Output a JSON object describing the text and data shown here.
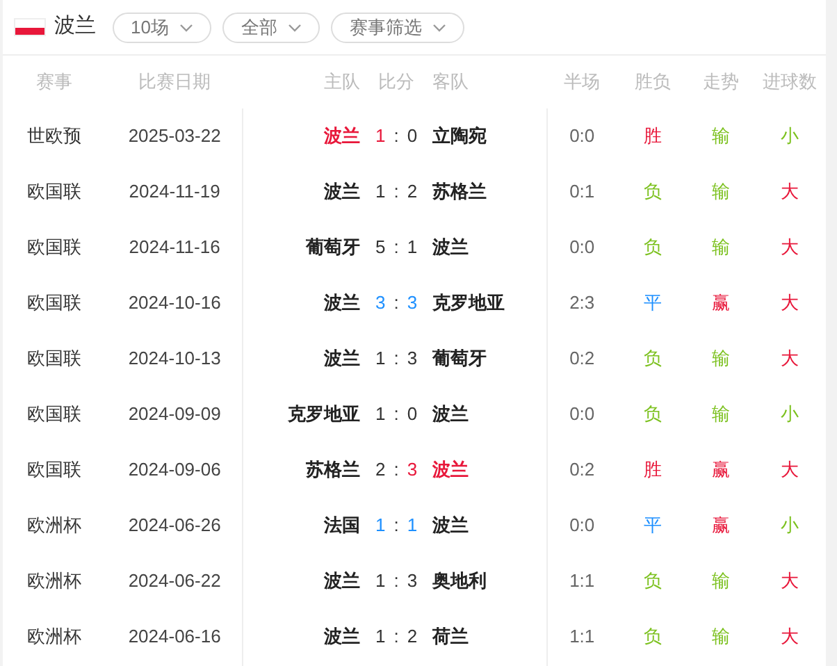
{
  "team": {
    "name": "波兰"
  },
  "filters": [
    {
      "label": "10场"
    },
    {
      "label": "全部"
    },
    {
      "label": "赛事筛选"
    }
  ],
  "columns": [
    "赛事",
    "比赛日期",
    "主队",
    "比分",
    "客队",
    "半场",
    "胜负",
    "走势",
    "进球数"
  ],
  "rows": [
    {
      "league": "世欧预",
      "date": "2025-03-22",
      "home": {
        "text": "波兰",
        "color": "#e8173a"
      },
      "home_score": {
        "text": "1",
        "color": "#e8173a"
      },
      "separator": ":",
      "away_score": {
        "text": "0",
        "color": "#333333"
      },
      "away": {
        "text": "立陶宛",
        "color": "#222222"
      },
      "half": "0:0",
      "result": {
        "text": "胜",
        "color": "#e8173a"
      },
      "trend": {
        "text": "输",
        "color": "#7cc11f"
      },
      "goals": {
        "text": "小",
        "color": "#7cc11f"
      }
    },
    {
      "league": "欧国联",
      "date": "2024-11-19",
      "home": {
        "text": "波兰",
        "color": "#222222"
      },
      "home_score": {
        "text": "1",
        "color": "#333333"
      },
      "separator": ":",
      "away_score": {
        "text": "2",
        "color": "#333333"
      },
      "away": {
        "text": "苏格兰",
        "color": "#222222"
      },
      "half": "0:1",
      "result": {
        "text": "负",
        "color": "#7cc11f"
      },
      "trend": {
        "text": "输",
        "color": "#7cc11f"
      },
      "goals": {
        "text": "大",
        "color": "#e8173a"
      }
    },
    {
      "league": "欧国联",
      "date": "2024-11-16",
      "home": {
        "text": "葡萄牙",
        "color": "#222222"
      },
      "home_score": {
        "text": "5",
        "color": "#333333"
      },
      "separator": ":",
      "away_score": {
        "text": "1",
        "color": "#333333"
      },
      "away": {
        "text": "波兰",
        "color": "#222222"
      },
      "half": "0:0",
      "result": {
        "text": "负",
        "color": "#7cc11f"
      },
      "trend": {
        "text": "输",
        "color": "#7cc11f"
      },
      "goals": {
        "text": "大",
        "color": "#e8173a"
      }
    },
    {
      "league": "欧国联",
      "date": "2024-10-16",
      "home": {
        "text": "波兰",
        "color": "#222222"
      },
      "home_score": {
        "text": "3",
        "color": "#1e90ff"
      },
      "separator": ":",
      "away_score": {
        "text": "3",
        "color": "#1e90ff"
      },
      "away": {
        "text": "克罗地亚",
        "color": "#222222"
      },
      "half": "2:3",
      "result": {
        "text": "平",
        "color": "#1e90ff"
      },
      "trend": {
        "text": "赢",
        "color": "#e8173a"
      },
      "goals": {
        "text": "大",
        "color": "#e8173a"
      }
    },
    {
      "league": "欧国联",
      "date": "2024-10-13",
      "home": {
        "text": "波兰",
        "color": "#222222"
      },
      "home_score": {
        "text": "1",
        "color": "#333333"
      },
      "separator": ":",
      "away_score": {
        "text": "3",
        "color": "#333333"
      },
      "away": {
        "text": "葡萄牙",
        "color": "#222222"
      },
      "half": "0:2",
      "result": {
        "text": "负",
        "color": "#7cc11f"
      },
      "trend": {
        "text": "输",
        "color": "#7cc11f"
      },
      "goals": {
        "text": "大",
        "color": "#e8173a"
      }
    },
    {
      "league": "欧国联",
      "date": "2024-09-09",
      "home": {
        "text": "克罗地亚",
        "color": "#222222"
      },
      "home_score": {
        "text": "1",
        "color": "#333333"
      },
      "separator": ":",
      "away_score": {
        "text": "0",
        "color": "#333333"
      },
      "away": {
        "text": "波兰",
        "color": "#222222"
      },
      "half": "0:0",
      "result": {
        "text": "负",
        "color": "#7cc11f"
      },
      "trend": {
        "text": "输",
        "color": "#7cc11f"
      },
      "goals": {
        "text": "小",
        "color": "#7cc11f"
      }
    },
    {
      "league": "欧国联",
      "date": "2024-09-06",
      "home": {
        "text": "苏格兰",
        "color": "#222222"
      },
      "home_score": {
        "text": "2",
        "color": "#333333"
      },
      "separator": ":",
      "away_score": {
        "text": "3",
        "color": "#e8173a"
      },
      "away": {
        "text": "波兰",
        "color": "#e8173a"
      },
      "half": "0:2",
      "result": {
        "text": "胜",
        "color": "#e8173a"
      },
      "trend": {
        "text": "赢",
        "color": "#e8173a"
      },
      "goals": {
        "text": "大",
        "color": "#e8173a"
      }
    },
    {
      "league": "欧洲杯",
      "date": "2024-06-26",
      "home": {
        "text": "法国",
        "color": "#222222"
      },
      "home_score": {
        "text": "1",
        "color": "#1e90ff"
      },
      "separator": ":",
      "away_score": {
        "text": "1",
        "color": "#1e90ff"
      },
      "away": {
        "text": "波兰",
        "color": "#222222"
      },
      "half": "0:0",
      "result": {
        "text": "平",
        "color": "#1e90ff"
      },
      "trend": {
        "text": "赢",
        "color": "#e8173a"
      },
      "goals": {
        "text": "小",
        "color": "#7cc11f"
      }
    },
    {
      "league": "欧洲杯",
      "date": "2024-06-22",
      "home": {
        "text": "波兰",
        "color": "#222222"
      },
      "home_score": {
        "text": "1",
        "color": "#333333"
      },
      "separator": ":",
      "away_score": {
        "text": "3",
        "color": "#333333"
      },
      "away": {
        "text": "奥地利",
        "color": "#222222"
      },
      "half": "1:1",
      "result": {
        "text": "负",
        "color": "#7cc11f"
      },
      "trend": {
        "text": "输",
        "color": "#7cc11f"
      },
      "goals": {
        "text": "大",
        "color": "#e8173a"
      }
    },
    {
      "league": "欧洲杯",
      "date": "2024-06-16",
      "home": {
        "text": "波兰",
        "color": "#222222"
      },
      "home_score": {
        "text": "1",
        "color": "#333333"
      },
      "separator": ":",
      "away_score": {
        "text": "2",
        "color": "#333333"
      },
      "away": {
        "text": "荷兰",
        "color": "#222222"
      },
      "half": "1:1",
      "result": {
        "text": "负",
        "color": "#7cc11f"
      },
      "trend": {
        "text": "输",
        "color": "#7cc11f"
      },
      "goals": {
        "text": "大",
        "color": "#e8173a"
      }
    }
  ]
}
